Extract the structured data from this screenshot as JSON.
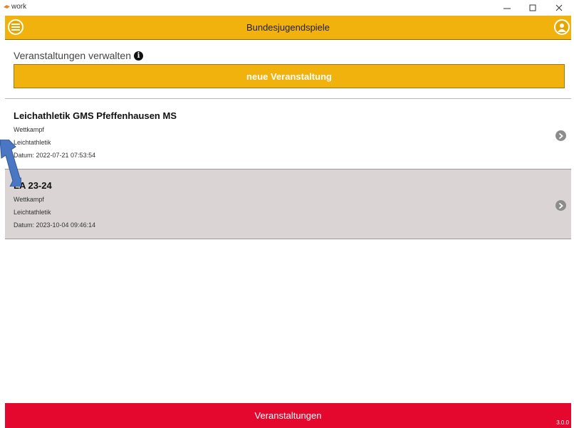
{
  "window": {
    "title": "work",
    "controls": [
      "minimize",
      "maximize",
      "close"
    ]
  },
  "header": {
    "title": "Bundesjugendspiele",
    "menu_icon": "menu-icon",
    "user_icon": "user-icon",
    "accent_color": "#f2b20d"
  },
  "management": {
    "label": "Veranstaltungen verwalten",
    "info_icon": "i",
    "new_event_label": "neue Veranstaltung"
  },
  "events": [
    {
      "title": "Leichathletik GMS Pfeffenhausen MS",
      "type": "Wettkampf",
      "sport": "Leichtathletik",
      "date": "Datum: 2022-07-21 07:53:54"
    },
    {
      "title": "LA 23-24",
      "type": "Wettkampf",
      "sport": "Leichtathletik",
      "date": "Datum: 2023-10-04 09:46:14",
      "selected": true
    }
  ],
  "bottom_bar": {
    "label": "Veranstaltungen",
    "version": "3.0.0",
    "color": "#e4082f"
  }
}
